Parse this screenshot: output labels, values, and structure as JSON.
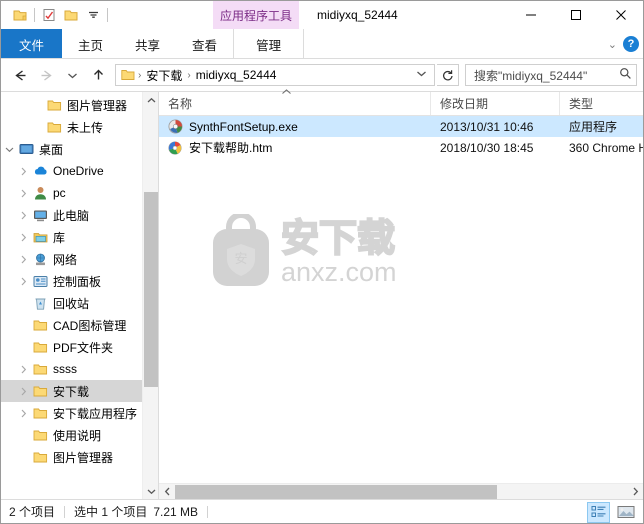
{
  "window": {
    "title": "midiyxq_52444",
    "contextual_tab_group": "应用程序工具",
    "minimize": "—",
    "maximize": "□",
    "close": "✕"
  },
  "quick_access": [
    {
      "name": "folder-icon",
      "label": "文件夹"
    },
    {
      "name": "properties-icon",
      "label": "属性"
    },
    {
      "name": "new-folder-icon",
      "label": "新建文件夹"
    },
    {
      "name": "chevron-down-icon",
      "label": "自定义快速访问工具栏"
    }
  ],
  "ribbon": {
    "tabs": [
      {
        "label": "文件",
        "active": true,
        "kind": "file"
      },
      {
        "label": "主页",
        "active": false,
        "kind": "normal"
      },
      {
        "label": "共享",
        "active": false,
        "kind": "normal"
      },
      {
        "label": "查看",
        "active": false,
        "kind": "normal"
      },
      {
        "label": "管理",
        "active": false,
        "kind": "contextual"
      }
    ],
    "collapse_icon": "⌄",
    "help_label": "?"
  },
  "navbar": {
    "back": "←",
    "forward": "→",
    "recent": "⌄",
    "up": "↑",
    "breadcrumbs": [
      {
        "label": "安下载"
      },
      {
        "label": "midiyxq_52444"
      }
    ],
    "breadcrumb_sep": "›",
    "address_dropdown": "⌄",
    "refresh": "↻",
    "search_value": "搜索\"midiyxq_52444\"",
    "search_icon": "search-icon"
  },
  "sidebar": {
    "items": [
      {
        "label": "图片管理器",
        "icon": "folder-icon",
        "indent": 2,
        "chevron": "none",
        "selected": false
      },
      {
        "label": "未上传",
        "icon": "folder-icon",
        "indent": 2,
        "chevron": "none",
        "selected": false
      },
      {
        "label": "桌面",
        "icon": "desktop-icon",
        "indent": 0,
        "chevron": "expanded",
        "selected": false
      },
      {
        "label": "OneDrive",
        "icon": "cloud-icon",
        "indent": 1,
        "chevron": "collapsed",
        "selected": false
      },
      {
        "label": "pc",
        "icon": "user-icon",
        "indent": 1,
        "chevron": "collapsed",
        "selected": false
      },
      {
        "label": "此电脑",
        "icon": "computer-icon",
        "indent": 1,
        "chevron": "collapsed",
        "selected": false
      },
      {
        "label": "库",
        "icon": "library-icon",
        "indent": 1,
        "chevron": "collapsed",
        "selected": false
      },
      {
        "label": "网络",
        "icon": "network-icon",
        "indent": 1,
        "chevron": "collapsed",
        "selected": false
      },
      {
        "label": "控制面板",
        "icon": "control-panel-icon",
        "indent": 1,
        "chevron": "collapsed",
        "selected": false
      },
      {
        "label": "回收站",
        "icon": "recycle-bin-icon",
        "indent": 1,
        "chevron": "none",
        "selected": false
      },
      {
        "label": "CAD图标管理",
        "icon": "folder-icon",
        "indent": 1,
        "chevron": "none",
        "selected": false
      },
      {
        "label": "PDF文件夹",
        "icon": "folder-icon",
        "indent": 1,
        "chevron": "none",
        "selected": false
      },
      {
        "label": "ssss",
        "icon": "folder-icon",
        "indent": 1,
        "chevron": "collapsed",
        "selected": false
      },
      {
        "label": "安下载",
        "icon": "folder-icon",
        "indent": 1,
        "chevron": "collapsed",
        "selected": true
      },
      {
        "label": "安下载应用程序",
        "icon": "folder-icon",
        "indent": 1,
        "chevron": "collapsed",
        "selected": false
      },
      {
        "label": "使用说明",
        "icon": "folder-icon",
        "indent": 1,
        "chevron": "none",
        "selected": false
      },
      {
        "label": "图片管理器",
        "icon": "folder-icon",
        "indent": 1,
        "chevron": "none",
        "selected": false
      }
    ],
    "scroll_up": "⌃",
    "scroll_down": "⌄"
  },
  "file_list": {
    "columns": [
      {
        "label": "名称",
        "sorted": true,
        "sort_dir": "asc"
      },
      {
        "label": "修改日期",
        "sorted": false
      },
      {
        "label": "类型",
        "sorted": false
      }
    ],
    "sort_caret": "⌃",
    "rows": [
      {
        "name": "SynthFontSetup.exe",
        "date": "2013/10/31 10:46",
        "type": "应用程序",
        "icon": "exe-icon",
        "selected": true
      },
      {
        "name": "安下载帮助.htm",
        "date": "2018/10/30 18:45",
        "type": "360 Chrome H",
        "icon": "html-icon",
        "selected": false
      }
    ],
    "watermark_text": "anxz.com",
    "watermark_logo": "安下载",
    "hscroll_left": "‹",
    "hscroll_right": "›"
  },
  "statusbar": {
    "item_count": "2 个项目",
    "selection": "选中 1 个项目",
    "size": "7.21 MB",
    "views": [
      {
        "name": "details-view-icon",
        "active": true
      },
      {
        "name": "large-icons-view-icon",
        "active": false
      }
    ]
  },
  "colors": {
    "file_tab": "#1976c8",
    "contextual": "#f4dcf6",
    "contextual_text": "#7b2c86",
    "selection": "#cce8ff",
    "tree_selection": "#d6d6d6"
  }
}
